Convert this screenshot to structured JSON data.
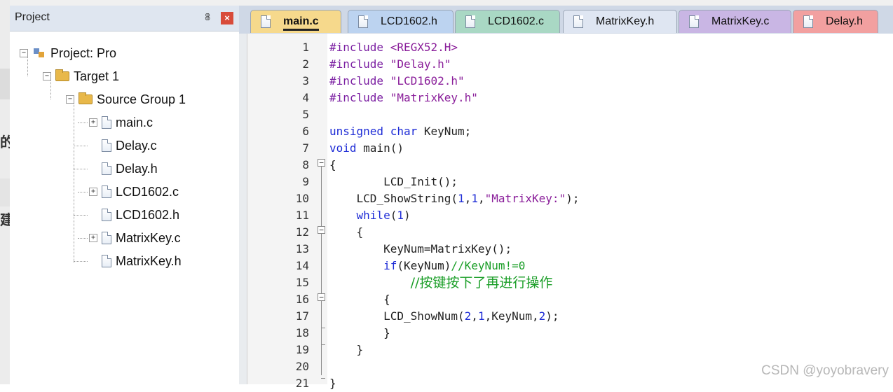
{
  "project_panel": {
    "title": "Project",
    "pin_glyph": "ᴾ",
    "close_glyph": "×",
    "tree": {
      "project": "Project: Pro",
      "target": "Target 1",
      "group": "Source Group 1",
      "files": [
        "main.c",
        "Delay.c",
        "Delay.h",
        "LCD1602.c",
        "LCD1602.h",
        "MatrixKey.c",
        "MatrixKey.h"
      ]
    }
  },
  "tabs": [
    {
      "label": "main.c",
      "color": "#f6d98c",
      "active": true
    },
    {
      "label": "LCD1602.h",
      "color": "#bcd3f0",
      "active": false
    },
    {
      "label": "LCD1602.c",
      "color": "#a9d8c4",
      "active": false
    },
    {
      "label": "MatrixKey.h",
      "color": "#dfe6f2",
      "active": false
    },
    {
      "label": "MatrixKey.c",
      "color": "#c9b6e4",
      "active": false
    },
    {
      "label": "Delay.h",
      "color": "#f2a0a0",
      "active": false
    }
  ],
  "code_lines": [
    {
      "n": "1",
      "segs": [
        [
          "pp",
          "#include "
        ],
        [
          "str",
          "<REGX52.H>"
        ]
      ]
    },
    {
      "n": "2",
      "segs": [
        [
          "pp",
          "#include "
        ],
        [
          "str",
          "\"Delay.h\""
        ]
      ]
    },
    {
      "n": "3",
      "segs": [
        [
          "pp",
          "#include "
        ],
        [
          "str",
          "\"LCD1602.h\""
        ]
      ]
    },
    {
      "n": "4",
      "segs": [
        [
          "pp",
          "#include "
        ],
        [
          "str",
          "\"MatrixKey.h\""
        ]
      ]
    },
    {
      "n": "5",
      "segs": []
    },
    {
      "n": "6",
      "segs": [
        [
          "kw",
          "unsigned char"
        ],
        [
          "",
          " KeyNum;"
        ]
      ]
    },
    {
      "n": "7",
      "segs": [
        [
          "kw",
          "void"
        ],
        [
          "",
          " main()"
        ]
      ]
    },
    {
      "n": "8",
      "segs": [
        [
          "",
          "{"
        ]
      ]
    },
    {
      "n": "9",
      "segs": [
        [
          "",
          "        LCD_Init();"
        ]
      ]
    },
    {
      "n": "10",
      "segs": [
        [
          "",
          "    LCD_ShowString("
        ],
        [
          "num",
          "1"
        ],
        [
          "",
          ","
        ],
        [
          "num",
          "1"
        ],
        [
          "",
          ","
        ],
        [
          "str",
          "\"MatrixKey:\""
        ],
        [
          "",
          ");"
        ]
      ]
    },
    {
      "n": "11",
      "segs": [
        [
          "",
          "    "
        ],
        [
          "kw",
          "while"
        ],
        [
          "",
          "("
        ],
        [
          "num",
          "1"
        ],
        [
          "",
          ")"
        ]
      ]
    },
    {
      "n": "12",
      "segs": [
        [
          "",
          "    {"
        ]
      ]
    },
    {
      "n": "13",
      "segs": [
        [
          "",
          "        KeyNum=MatrixKey();"
        ]
      ]
    },
    {
      "n": "14",
      "segs": [
        [
          "",
          "        "
        ],
        [
          "kw",
          "if"
        ],
        [
          "",
          "(KeyNum)"
        ],
        [
          "cmt",
          "//KeyNum!=0"
        ]
      ]
    },
    {
      "n": "15",
      "segs": [
        [
          "",
          "            "
        ],
        [
          "cmt cn",
          "//按键按下了再进行操作"
        ]
      ]
    },
    {
      "n": "16",
      "segs": [
        [
          "",
          "        {"
        ]
      ]
    },
    {
      "n": "17",
      "segs": [
        [
          "",
          "        LCD_ShowNum("
        ],
        [
          "num",
          "2"
        ],
        [
          "",
          ","
        ],
        [
          "num",
          "1"
        ],
        [
          "",
          ",KeyNum,"
        ],
        [
          "num",
          "2"
        ],
        [
          "",
          ");"
        ]
      ]
    },
    {
      "n": "18",
      "segs": [
        [
          "",
          "        }"
        ]
      ]
    },
    {
      "n": "19",
      "segs": [
        [
          "",
          "    }"
        ]
      ]
    },
    {
      "n": "20",
      "segs": []
    },
    {
      "n": "21",
      "segs": [
        [
          "",
          "}"
        ]
      ]
    }
  ],
  "watermark": "CSDN @yoyobravery",
  "stray_chars": [
    "的",
    "建"
  ]
}
